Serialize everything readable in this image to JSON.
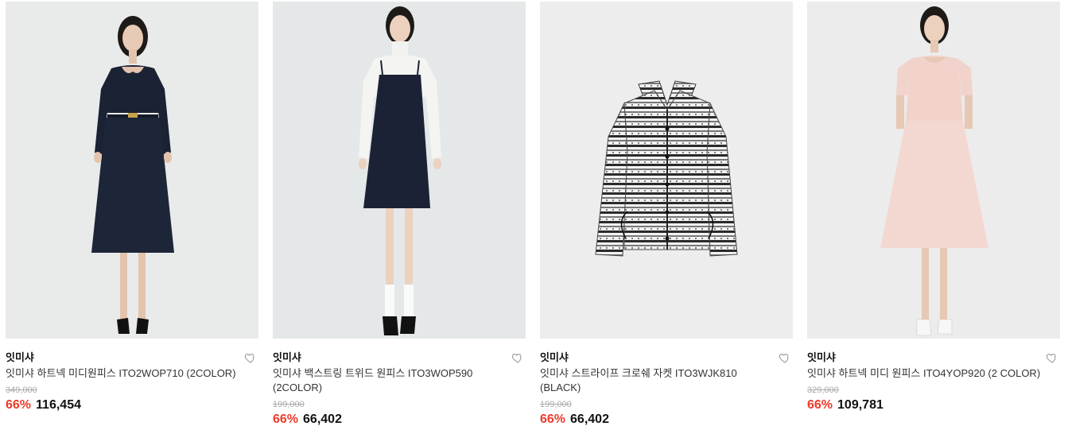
{
  "products": [
    {
      "brand": "잇미샤",
      "name": "잇미샤 하트넥 미디원피스 ITO2WOP710 (2COLOR)",
      "original_price": "349,000",
      "discount": "66%",
      "price": "116,454",
      "image": "navy-midi-dress"
    },
    {
      "brand": "잇미샤",
      "name": "잇미샤 백스트링 트위드 원피스 ITO3WOP590 (2COLOR)",
      "original_price": "199,000",
      "discount": "66%",
      "price": "66,402",
      "image": "navy-tweed-slip-dress"
    },
    {
      "brand": "잇미샤",
      "name": "잇미샤 스트라이프 크로쉐 자켓 ITO3WJK810 (BLACK)",
      "original_price": "199,000",
      "discount": "66%",
      "price": "66,402",
      "image": "striped-crochet-jacket"
    },
    {
      "brand": "잇미샤",
      "name": "잇미샤 하트넥 미디 원피스 ITO4YOP920 (2 COLOR)",
      "original_price": "329,000",
      "discount": "66%",
      "price": "109,781",
      "image": "pink-midi-dress"
    }
  ],
  "colors": {
    "discount": "#ec3b2b",
    "strike": "#aaaaaa",
    "image_bg": "#ebecec"
  },
  "icons": {
    "wishlist": "heart-outline-icon"
  }
}
